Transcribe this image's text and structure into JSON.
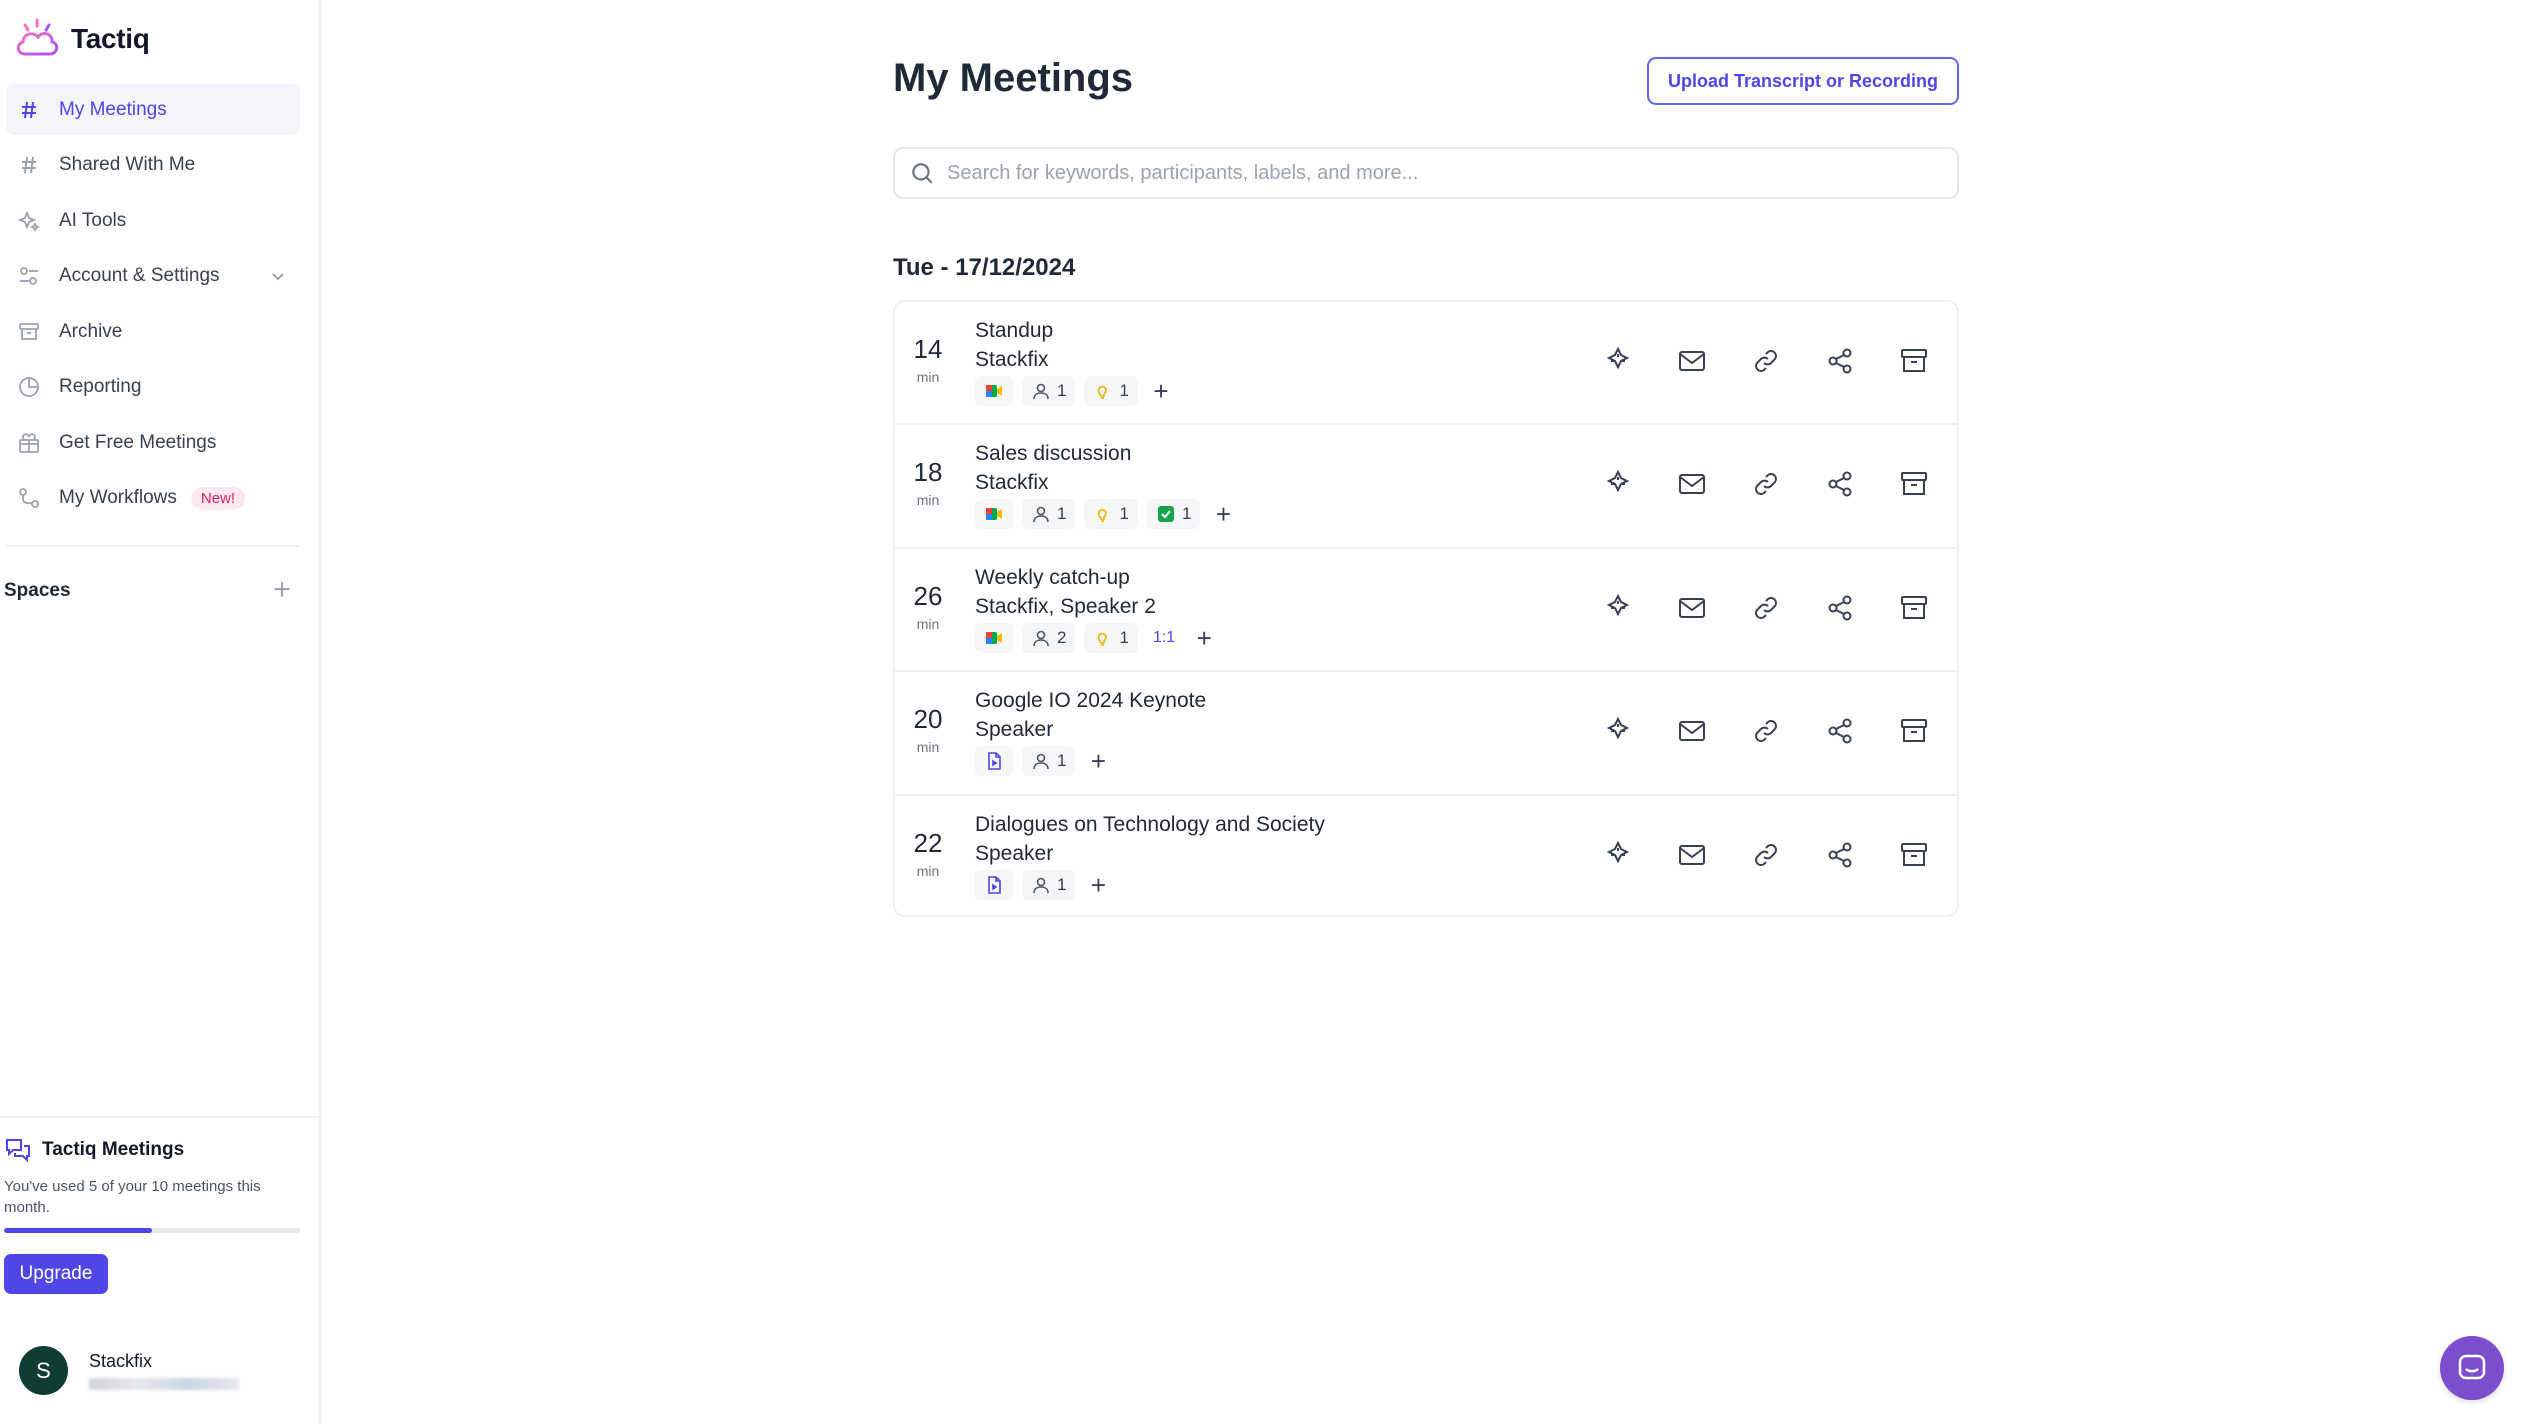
{
  "brand": {
    "name": "Tactiq"
  },
  "sidebar": {
    "items": [
      {
        "label": "My Meetings",
        "icon": "hash-icon",
        "active": true
      },
      {
        "label": "Shared With Me",
        "icon": "hash-icon"
      },
      {
        "label": "AI Tools",
        "icon": "sparkles-icon"
      },
      {
        "label": "Account & Settings",
        "icon": "settings-sliders-icon"
      },
      {
        "label": "Archive",
        "icon": "archive-icon"
      },
      {
        "label": "Reporting",
        "icon": "pie-chart-icon"
      },
      {
        "label": "Get Free Meetings",
        "icon": "gift-icon"
      },
      {
        "label": "My Workflows",
        "icon": "workflow-icon",
        "badge": "New!"
      }
    ],
    "spaces_label": "Spaces",
    "usage": {
      "title": "Tactiq Meetings",
      "text": "You've used 5 of your 10 meetings this month.",
      "used": 5,
      "total": 10
    },
    "upgrade_label": "Upgrade",
    "user": {
      "initial": "S",
      "name": "Stackfix"
    }
  },
  "main": {
    "title": "My Meetings",
    "upload_label": "Upload Transcript or Recording",
    "search_placeholder": "Search for keywords, participants, labels, and more...",
    "date_heading": "Tue - 17/12/2024",
    "meetings": [
      {
        "duration": "14",
        "unit": "min",
        "title": "Standup",
        "participants": "Stackfix",
        "source": "google-meet-icon",
        "people": "1",
        "highlights": "1"
      },
      {
        "duration": "18",
        "unit": "min",
        "title": "Sales discussion",
        "participants": "Stackfix",
        "source": "google-meet-icon",
        "people": "1",
        "highlights": "1",
        "actions": "1"
      },
      {
        "duration": "26",
        "unit": "min",
        "title": "Weekly catch-up",
        "participants": "Stackfix, Speaker 2",
        "source": "google-meet-icon",
        "people": "2",
        "highlights": "1",
        "label": "1:1"
      },
      {
        "duration": "20",
        "unit": "min",
        "title": "Google IO 2024 Keynote",
        "participants": "Speaker",
        "source": "uploaded-file-icon",
        "people": "1"
      },
      {
        "duration": "22",
        "unit": "min",
        "title": "Dialogues on Technology and Society",
        "participants": "Speaker",
        "source": "uploaded-file-icon",
        "people": "1"
      }
    ]
  },
  "colors": {
    "accent": "#4f46e5",
    "badge_bg": "#fde8ef",
    "badge_text": "#e11d66",
    "fab": "#7c4dcc"
  }
}
